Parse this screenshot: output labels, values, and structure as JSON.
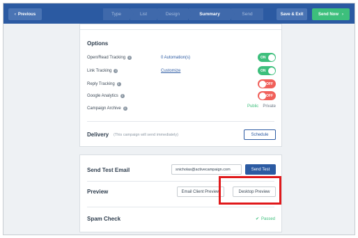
{
  "topbar": {
    "previous_label": "Previous",
    "previous_icon": "chevron-left-icon",
    "steps": [
      {
        "label": "Type"
      },
      {
        "label": "List"
      },
      {
        "label": "Design"
      },
      {
        "label": "Summary"
      },
      {
        "label": "Send"
      }
    ],
    "active_step": "Summary",
    "save_exit_label": "Save & Exit",
    "send_now_label": "Send Now",
    "send_now_icon": "chevron-right-icon",
    "colors": {
      "bar": "#2b5aa2",
      "step": "#3f69ab",
      "send_now": "#3dbf7c"
    }
  },
  "options": {
    "title": "Options",
    "open_read": {
      "label": "Open/Read Tracking",
      "link": "0 Automation(s)",
      "toggle": "ON"
    },
    "link_tracking": {
      "label": "Link Tracking",
      "link": "Customize",
      "toggle": "ON"
    },
    "reply_tracking": {
      "label": "Reply Tracking",
      "toggle": "OFF"
    },
    "google_analytics": {
      "label": "Google Analytics",
      "toggle": "OFF"
    },
    "campaign_archive": {
      "label": "Campaign Archive",
      "public": "Public",
      "private": "Private"
    }
  },
  "delivery": {
    "title": "Delivery",
    "note": "(This campaign will send immediately)",
    "schedule_label": "Schedule"
  },
  "send_test": {
    "title": "Send Test Email",
    "email_value": "snicholas@activecampaign.com",
    "button_label": "Send Test"
  },
  "preview": {
    "title": "Preview",
    "email_client_label": "Email Client Preview",
    "desktop_label": "Desktop Preview"
  },
  "spam": {
    "title": "Spam Check",
    "status": "Passed",
    "status_icon": "checkmark-icon"
  },
  "colors": {
    "accent": "#2b5aa2",
    "on": "#3dbf7c",
    "off": "#f0605a",
    "highlight": "#e0191b"
  }
}
